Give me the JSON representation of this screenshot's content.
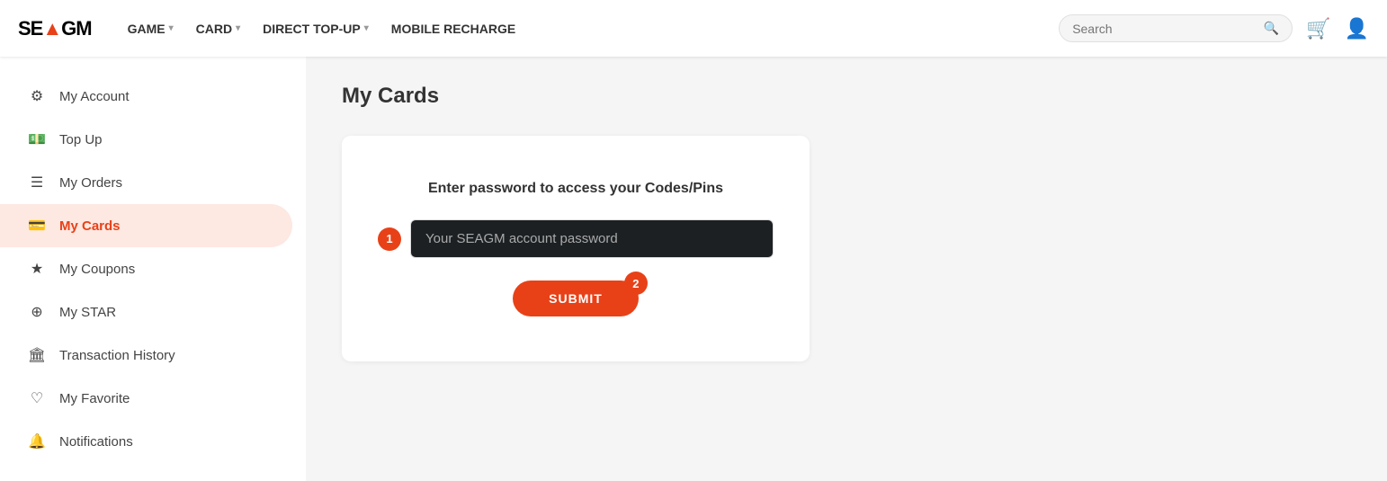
{
  "header": {
    "logo": "SE▲GM",
    "logo_text": "SEAGM",
    "nav_items": [
      {
        "label": "GAME",
        "has_dropdown": true
      },
      {
        "label": "CARD",
        "has_dropdown": true
      },
      {
        "label": "DIRECT TOP-UP",
        "has_dropdown": true
      },
      {
        "label": "MOBILE RECHARGE",
        "has_dropdown": false
      }
    ],
    "search_placeholder": "Search"
  },
  "sidebar": {
    "items": [
      {
        "id": "account",
        "label": "My Account",
        "icon": "⚙"
      },
      {
        "id": "topup",
        "label": "Top Up",
        "icon": "💵"
      },
      {
        "id": "orders",
        "label": "My Orders",
        "icon": "☰"
      },
      {
        "id": "cards",
        "label": "My Cards",
        "icon": "💳",
        "active": true
      },
      {
        "id": "coupons",
        "label": "My Coupons",
        "icon": "★"
      },
      {
        "id": "star",
        "label": "My STAR",
        "icon": "⊕"
      },
      {
        "id": "history",
        "label": "Transaction History",
        "icon": "🏛"
      },
      {
        "id": "favorite",
        "label": "My Favorite",
        "icon": "♡"
      },
      {
        "id": "notifications",
        "label": "Notifications",
        "icon": "🔔"
      }
    ]
  },
  "main": {
    "page_title": "My Cards",
    "card_panel": {
      "instruction": "Enter password to access your Codes/Pins",
      "step1_badge": "1",
      "step2_badge": "2",
      "password_placeholder": "Your SEAGM account password",
      "submit_label": "SUBMIT"
    }
  }
}
